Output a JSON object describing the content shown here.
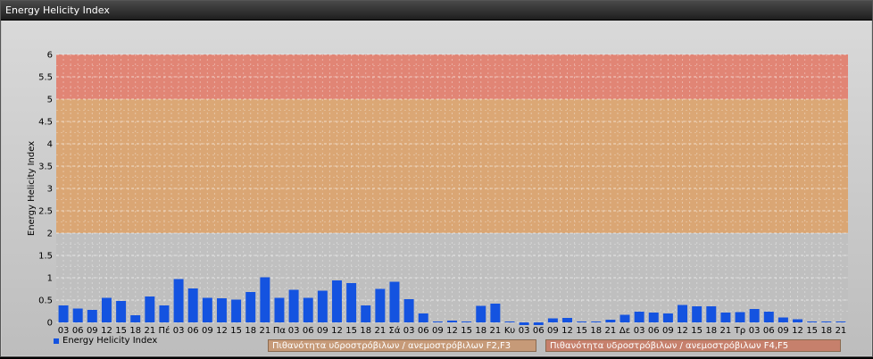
{
  "window": {
    "title": "Energy Helicity Index"
  },
  "colors": {
    "bar": "#1453e0",
    "band_low": "#bfbfbf",
    "band_mid": "#dca26a",
    "band_high": "#e27c6a",
    "legend_mid": "#c69a78",
    "legend_high": "#c6806c"
  },
  "legend": {
    "series_label": "Energy Helicity Index",
    "band_mid_label": "Πιθανότητα υδροστρόβιλων / ανεμοστρόβιλων F2,F3",
    "band_high_label": "Πιθανότητα υδροστρόβιλων / ανεμοστρόβιλων F4,F5"
  },
  "chart_data": {
    "type": "bar",
    "title": "",
    "xlabel": "",
    "ylabel": "Energy Helicity Index",
    "ylim": [
      0,
      6
    ],
    "yticks": [
      "0",
      "0.5",
      "1",
      "1.5",
      "2",
      "2.5",
      "3",
      "3.5",
      "4",
      "4.5",
      "5",
      "5.5",
      "6"
    ],
    "grid": true,
    "bands": [
      {
        "from": 0,
        "to": 2,
        "color": "#bfbfbf"
      },
      {
        "from": 2,
        "to": 5,
        "color": "#dca26a"
      },
      {
        "from": 5,
        "to": 6,
        "color": "#e27c6a"
      }
    ],
    "categories": [
      "03",
      "06",
      "09",
      "12",
      "15",
      "18",
      "21",
      "Πέ",
      "03",
      "06",
      "09",
      "12",
      "15",
      "18",
      "21",
      "Πα",
      "03",
      "06",
      "09",
      "12",
      "15",
      "18",
      "21",
      "Σά",
      "03",
      "06",
      "09",
      "12",
      "15",
      "18",
      "21",
      "Κυ",
      "03",
      "06",
      "09",
      "12",
      "15",
      "18",
      "21",
      "Δε",
      "03",
      "06",
      "09",
      "12",
      "15",
      "18",
      "21",
      "Τρ",
      "03",
      "06",
      "09",
      "12",
      "15",
      "18",
      "21"
    ],
    "series": [
      {
        "name": "Energy Helicity Index",
        "values": [
          0.38,
          0.31,
          0.28,
          0.55,
          0.48,
          0.16,
          0.58,
          0.38,
          0.97,
          0.76,
          0.55,
          0.54,
          0.51,
          0.68,
          1.01,
          0.55,
          0.73,
          0.55,
          0.71,
          0.94,
          0.88,
          0.38,
          0.75,
          0.91,
          0.52,
          0.2,
          0.02,
          0.04,
          0.02,
          0.37,
          0.42,
          0.02,
          -0.06,
          -0.06,
          0.09,
          0.1,
          0.02,
          0.02,
          0.06,
          0.17,
          0.24,
          0.22,
          0.2,
          0.39,
          0.36,
          0.36,
          0.22,
          0.23,
          0.3,
          0.24,
          0.11,
          0.07,
          0.02,
          0.02,
          0.02
        ]
      }
    ],
    "legend_position": "bottom-left"
  }
}
